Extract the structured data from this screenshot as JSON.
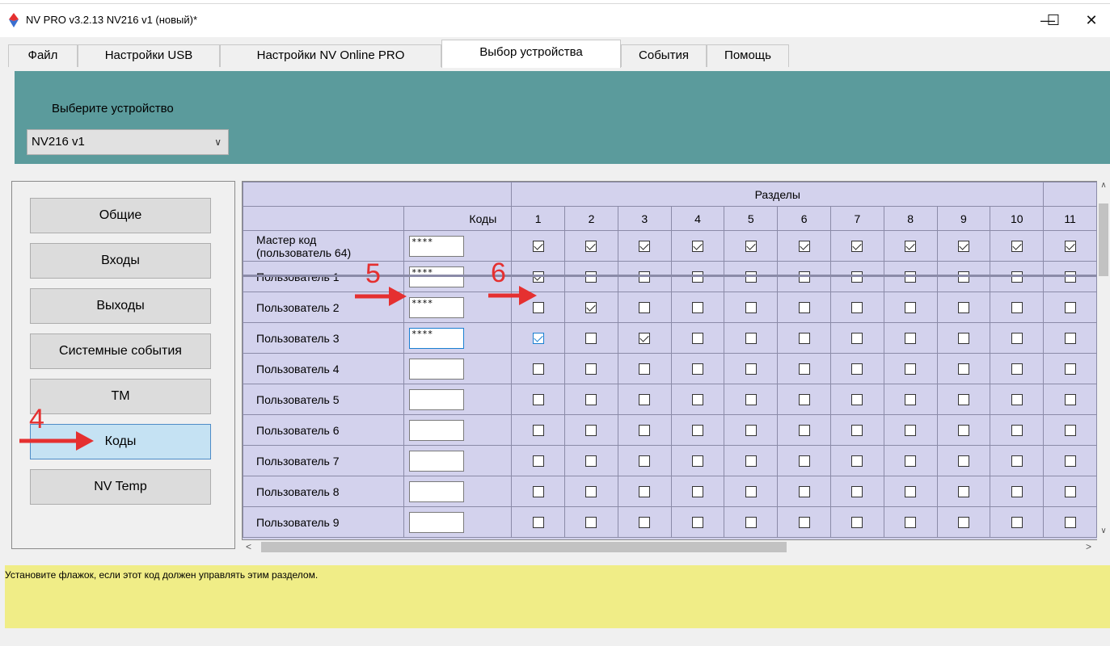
{
  "window": {
    "title": "NV PRO v3.2.13 NV216 v1 (новый)*",
    "minimize": "—",
    "maximize": "☐",
    "close": "✕"
  },
  "tabs": [
    "Файл",
    "Настройки USB",
    "Настройки NV Online PRO",
    "Выбор устройства",
    "События",
    "Помощь"
  ],
  "active_tab": "Выбор устройства",
  "device": {
    "label": "Выберите устройство",
    "selected": "NV216 v1"
  },
  "nav": [
    "Общие",
    "Входы",
    "Выходы",
    "Системные события",
    "ТМ",
    "Коды",
    "NV Temp"
  ],
  "active_nav": "Коды",
  "grid": {
    "sections_header": "Разделы",
    "codes_header": "Коды",
    "columns": [
      "1",
      "2",
      "3",
      "4",
      "5",
      "6",
      "7",
      "8",
      "9",
      "10",
      "11"
    ],
    "rows": [
      {
        "name": "Мастер код (пользователь 64)",
        "code": "****",
        "checks": [
          1,
          1,
          1,
          1,
          1,
          1,
          1,
          1,
          1,
          1,
          1
        ]
      },
      {
        "name": "Пользователь 1",
        "code": "****",
        "checks": [
          1,
          0,
          0,
          0,
          0,
          0,
          0,
          0,
          0,
          0,
          0
        ]
      },
      {
        "name": "Пользователь 2",
        "code": "****",
        "checks": [
          0,
          1,
          0,
          0,
          0,
          0,
          0,
          0,
          0,
          0,
          0
        ]
      },
      {
        "name": "Пользователь 3",
        "code": "****",
        "checks": [
          1,
          0,
          1,
          0,
          0,
          0,
          0,
          0,
          0,
          0,
          0
        ]
      },
      {
        "name": "Пользователь 4",
        "code": "",
        "checks": [
          0,
          0,
          0,
          0,
          0,
          0,
          0,
          0,
          0,
          0,
          0
        ]
      },
      {
        "name": "Пользователь 5",
        "code": "",
        "checks": [
          0,
          0,
          0,
          0,
          0,
          0,
          0,
          0,
          0,
          0,
          0
        ]
      },
      {
        "name": "Пользователь 6",
        "code": "",
        "checks": [
          0,
          0,
          0,
          0,
          0,
          0,
          0,
          0,
          0,
          0,
          0
        ]
      },
      {
        "name": "Пользователь 7",
        "code": "",
        "checks": [
          0,
          0,
          0,
          0,
          0,
          0,
          0,
          0,
          0,
          0,
          0
        ]
      },
      {
        "name": "Пользователь 8",
        "code": "",
        "checks": [
          0,
          0,
          0,
          0,
          0,
          0,
          0,
          0,
          0,
          0,
          0
        ]
      },
      {
        "name": "Пользователь 9",
        "code": "",
        "checks": [
          0,
          0,
          0,
          0,
          0,
          0,
          0,
          0,
          0,
          0,
          0
        ]
      }
    ]
  },
  "status": "Установите флажок, если этот код должен управлять этим разделом.",
  "annotations": {
    "a4": "4",
    "a5": "5",
    "a6": "6",
    "color": "#e53030"
  }
}
